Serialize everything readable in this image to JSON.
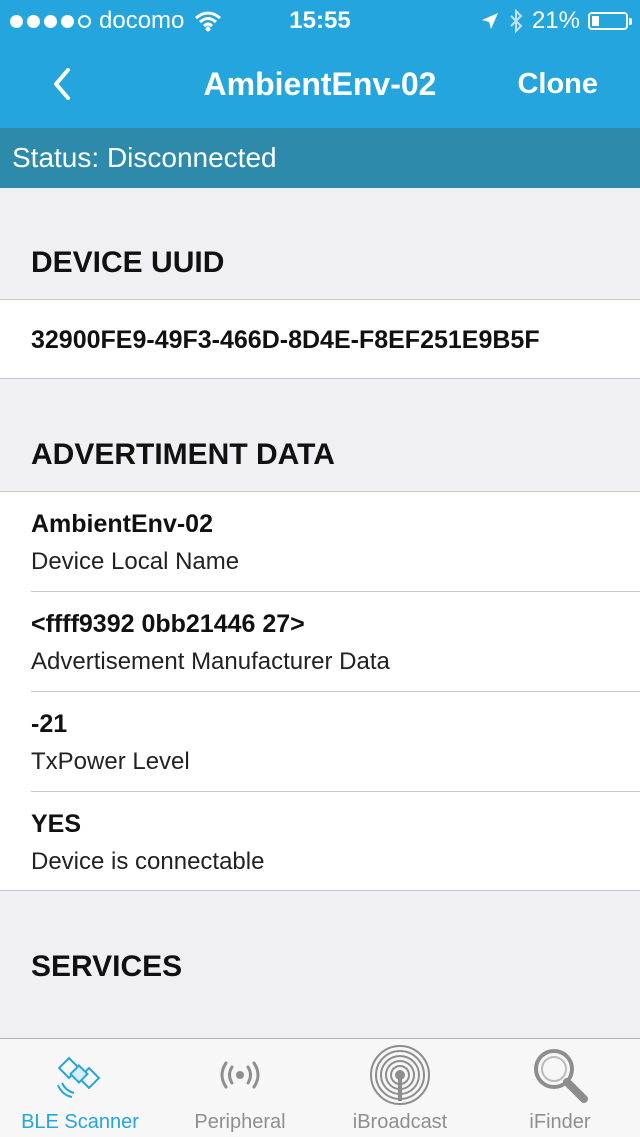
{
  "status_bar": {
    "carrier": "docomo",
    "time": "15:55",
    "battery": "21%",
    "battery_level": 0.21,
    "signal_bars": 4
  },
  "nav": {
    "title": "AmbientEnv-02",
    "right_button": "Clone",
    "back_icon": "chevron-left-icon"
  },
  "status_text": "Status: Disconnected",
  "sections": {
    "uuid": {
      "title": "DEVICE UUID",
      "value": "32900FE9-49F3-466D-8D4E-F8EF251E9B5F"
    },
    "advertisement": {
      "title": "ADVERTIMENT DATA",
      "items": [
        {
          "value": "AmbientEnv-02",
          "label": "Device Local Name"
        },
        {
          "value": "<ffff9392 0bb21446 27>",
          "label": "Advertisement Manufacturer Data"
        },
        {
          "value": "-21",
          "label": "TxPower Level"
        },
        {
          "value": "YES",
          "label": "Device is connectable"
        }
      ]
    },
    "services": {
      "title": "SERVICES"
    }
  },
  "tabs": [
    {
      "label": "BLE Scanner",
      "icon": "satellite-icon",
      "active": true
    },
    {
      "label": "Peripheral",
      "icon": "broadcast-signal-icon",
      "active": false
    },
    {
      "label": "iBroadcast",
      "icon": "ibroadcast-target-icon",
      "active": false
    },
    {
      "label": "iFinder",
      "icon": "magnifier-icon",
      "active": false
    }
  ],
  "colors": {
    "nav_blue": "#25a5dd",
    "status_strip": "#2d8aab",
    "background": "#efeff4",
    "tab_active": "#25a5dd",
    "tab_inactive": "#8e8e8e"
  }
}
